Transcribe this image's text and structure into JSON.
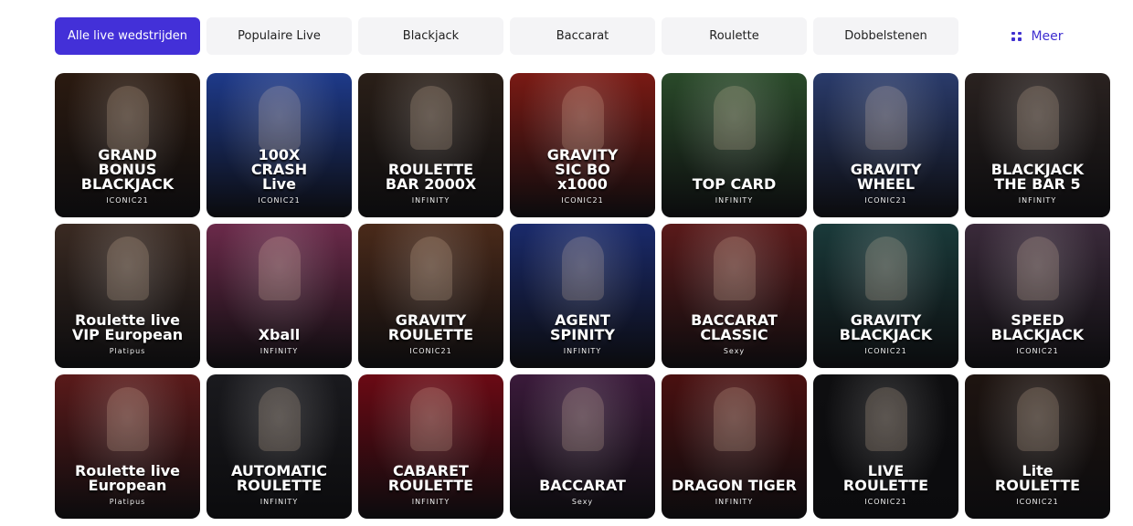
{
  "tabs": [
    {
      "label": "Alle live wedstrijden",
      "active": true,
      "name": "tab-all-live"
    },
    {
      "label": "Populaire Live",
      "active": false,
      "name": "tab-popular-live"
    },
    {
      "label": "Blackjack",
      "active": false,
      "name": "tab-blackjack"
    },
    {
      "label": "Baccarat",
      "active": false,
      "name": "tab-baccarat"
    },
    {
      "label": "Roulette",
      "active": false,
      "name": "tab-roulette"
    },
    {
      "label": "Dobbelstenen",
      "active": false,
      "name": "tab-dice"
    }
  ],
  "more": {
    "label": "Meer",
    "icon": "grid-dots-icon"
  },
  "games": [
    {
      "title": "GRAND\nBONUS\nBLACKJACK",
      "provider": "ICONIC21",
      "bg": "#2b1a10"
    },
    {
      "title": "100X\nCRASH\nLive",
      "provider": "ICONIC21",
      "bg": "#1e3a8a"
    },
    {
      "title": "ROULETTE\nBAR 2000X",
      "provider": "INFINITY",
      "bg": "#2a1f18"
    },
    {
      "title": "GRAVITY\nSIC BO\nx1000",
      "provider": "ICONIC21",
      "bg": "#7a1a14"
    },
    {
      "title": "TOP CARD",
      "provider": "INFINITY",
      "bg": "#2a4a2a"
    },
    {
      "title": "GRAVITY\nWHEEL",
      "provider": "ICONIC21",
      "bg": "#2a3b6b"
    },
    {
      "title": "BLACKJACK\nTHE BAR 5",
      "provider": "INFINITY",
      "bg": "#2a2220"
    },
    {
      "title": "Roulette live\nVIP European",
      "provider": "Platipus",
      "bg": "#3a2a22"
    },
    {
      "title": "Xball",
      "provider": "INFINITY",
      "bg": "#6b2a4a"
    },
    {
      "title": "GRAVITY\nROULETTE",
      "provider": "ICONIC21",
      "bg": "#4a2a1a"
    },
    {
      "title": "AGENT\nSPINITY",
      "provider": "INFINITY",
      "bg": "#1a2a6b"
    },
    {
      "title": "BACCARAT\nCLASSIC",
      "provider": "Sexy",
      "bg": "#5a1a1a"
    },
    {
      "title": "GRAVITY\nBLACKJACK",
      "provider": "ICONIC21",
      "bg": "#1a3a3a"
    },
    {
      "title": "SPEED\nBLACKJACK",
      "provider": "ICONIC21",
      "bg": "#3a2a3a"
    },
    {
      "title": "Roulette live\nEuropean",
      "provider": "Platipus",
      "bg": "#5a1a1a"
    },
    {
      "title": "AUTOMATIC\nROULETTE",
      "provider": "INFINITY",
      "bg": "#1a1a1e"
    },
    {
      "title": "CABARET\nROULETTE",
      "provider": "INFINITY",
      "bg": "#6b0a14"
    },
    {
      "title": "BACCARAT",
      "provider": "Sexy",
      "bg": "#3a1a3a"
    },
    {
      "title": "DRAGON TIGER",
      "provider": "INFINITY",
      "bg": "#4a1010"
    },
    {
      "title": "LIVE\nROULETTE",
      "provider": "ICONIC21",
      "bg": "#0e0e10"
    },
    {
      "title": "Lite\nROULETTE",
      "provider": "ICONIC21",
      "bg": "#1e1410"
    }
  ]
}
